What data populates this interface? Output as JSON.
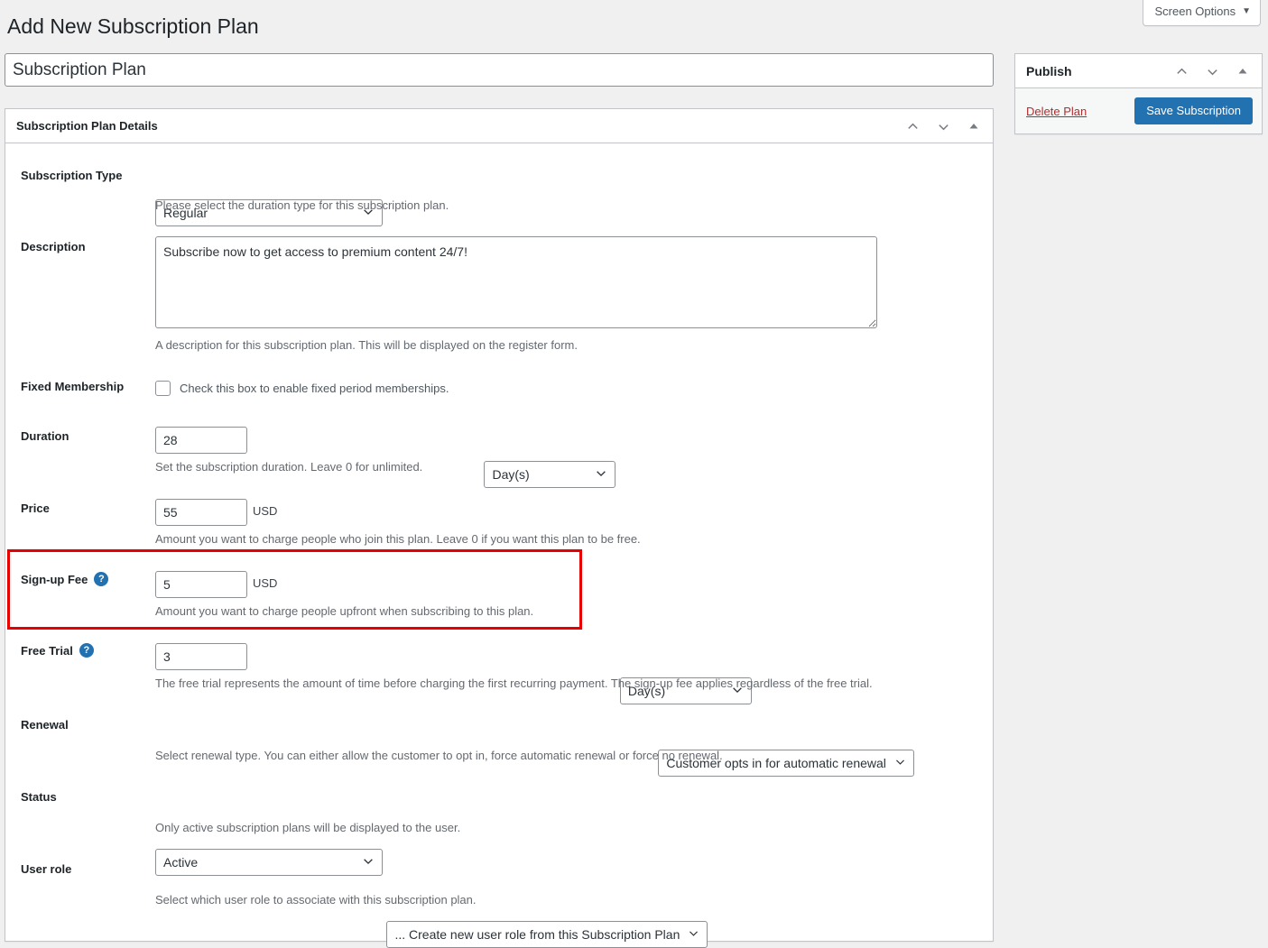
{
  "screen_options": {
    "label": "Screen Options",
    "caret_icon": "caret-down-icon"
  },
  "page": {
    "title": "Add New Subscription Plan"
  },
  "title_field": {
    "value": "Subscription Plan",
    "placeholder": "Enter title here"
  },
  "main_panel": {
    "header": "Subscription Plan Details",
    "actions": [
      {
        "name": "move-up-icon",
        "glyph": "chevron-up"
      },
      {
        "name": "move-down-icon",
        "glyph": "chevron-down"
      },
      {
        "name": "toggle-panel-icon",
        "glyph": "triangle-up"
      }
    ]
  },
  "fields": {
    "subscription_type": {
      "label": "Subscription Type",
      "value": "Regular",
      "description": "Please select the duration type for this subscription plan."
    },
    "description": {
      "label": "Description",
      "value": "Subscribe now to get access to premium content 24/7!",
      "description": "A description for this subscription plan. This will be displayed on the register form."
    },
    "fixed_membership": {
      "label": "Fixed Membership",
      "checkbox_label": "Check this box to enable fixed period memberships.",
      "checked": false
    },
    "duration": {
      "label": "Duration",
      "value": "28",
      "unit": "Day(s)",
      "description": "Set the subscription duration. Leave 0 for unlimited."
    },
    "price": {
      "label": "Price",
      "value": "55",
      "currency": "USD",
      "description": "Amount you want to charge people who join this plan. Leave 0 if you want this plan to be free."
    },
    "signup_fee": {
      "label": "Sign-up Fee",
      "help_icon": "help-icon",
      "value": "5",
      "currency": "USD",
      "description": "Amount you want to charge people upfront when subscribing to this plan.",
      "highlight_color": "#e60000"
    },
    "free_trial": {
      "label": "Free Trial",
      "help_icon": "help-icon",
      "value": "3",
      "unit": "Day(s)",
      "description": "The free trial represents the amount of time before charging the first recurring payment. The sign-up fee applies regardless of the free trial."
    },
    "renewal": {
      "label": "Renewal",
      "value": "Customer opts in for automatic renewal",
      "description": "Select renewal type. You can either allow the customer to opt in, force automatic renewal or force no renewal."
    },
    "status": {
      "label": "Status",
      "value": "Active",
      "description": "Only active subscription plans will be displayed to the user."
    },
    "user_role": {
      "label": "User role",
      "value": "... Create new user role from this Subscription Plan",
      "description": "Select which user role to associate with this subscription plan."
    }
  },
  "publish_panel": {
    "header": "Publish",
    "actions": [
      {
        "name": "move-up-icon",
        "glyph": "chevron-up"
      },
      {
        "name": "move-down-icon",
        "glyph": "chevron-down"
      },
      {
        "name": "toggle-panel-icon",
        "glyph": "triangle-up"
      }
    ],
    "delete_label": "Delete Plan",
    "save_label": "Save Subscription",
    "accent_color": "#2271b1",
    "delete_color": "#b32d2e"
  }
}
